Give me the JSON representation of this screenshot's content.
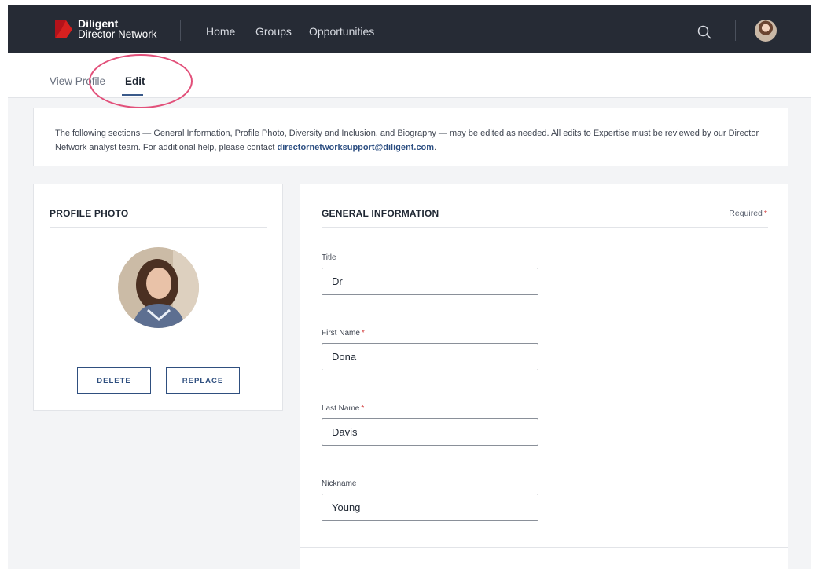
{
  "header": {
    "brand_line1": "Diligent",
    "brand_line2": "Director Network",
    "nav": [
      "Home",
      "Groups",
      "Opportunities"
    ],
    "accent_color": "#d6201f",
    "icons": {
      "search": "search-icon",
      "avatar": "user-avatar"
    }
  },
  "tabs": {
    "view_profile": "View Profile",
    "edit": "Edit",
    "active": "Edit"
  },
  "notice": {
    "text": "The following sections — General Information, Profile Photo, Diversity and Inclusion, and Biography — may be edited as needed. All edits to Expertise must be reviewed by our Director Network analyst team. For additional help, please contact ",
    "email": "directornetworksupport@diligent.com",
    "trailing": "."
  },
  "profile_photo": {
    "title": "PROFILE PHOTO",
    "delete_label": "DELETE",
    "replace_label": "REPLACE"
  },
  "general_information": {
    "title": "GENERAL INFORMATION",
    "required_label": "Required",
    "required_marker": "*",
    "fields": {
      "title": {
        "label": "Title",
        "value": "Dr",
        "required": false
      },
      "first_name": {
        "label": "First Name",
        "value": "Dona",
        "required": true
      },
      "last_name": {
        "label": "Last Name",
        "value": "Davis",
        "required": true
      },
      "nickname": {
        "label": "Nickname",
        "value": "Young",
        "required": false
      }
    }
  }
}
